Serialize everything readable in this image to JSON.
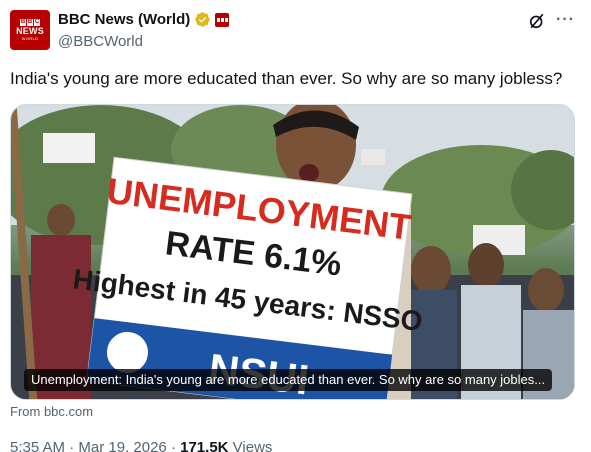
{
  "author": {
    "avatar_brand": "BBC",
    "avatar_line1": "NEWS",
    "avatar_line2": "WORLD",
    "name": "BBC News (World)",
    "handle": "@BBCWorld",
    "verified_icon": "gold-verified-badge",
    "affiliation_icon": "bbc-affiliate-badge"
  },
  "actions": {
    "grok_icon": "grok-icon",
    "more_icon": "more-horizontal-icon"
  },
  "tweet": {
    "text": "India's young are more educated than ever. So why are so many jobless?"
  },
  "media": {
    "caption": "Unemployment: India's young are more educated than ever. So why are so many jobles...",
    "placard": {
      "line1": "UNEMPLOYMENT",
      "line2": "RATE 6.1%",
      "line3": "Highest in 45 years: NSSO",
      "line4": "NSUI"
    }
  },
  "link": {
    "source": "From bbc.com"
  },
  "meta": {
    "time": "5:35 AM",
    "separator": "·",
    "date": "Mar 19, 2026",
    "views_count": "171.5K",
    "views_label": "Views"
  },
  "colors": {
    "brand_red": "#b80000",
    "text_primary": "#0f1419",
    "text_secondary": "#536471",
    "verified_gold": "#e2b719"
  }
}
